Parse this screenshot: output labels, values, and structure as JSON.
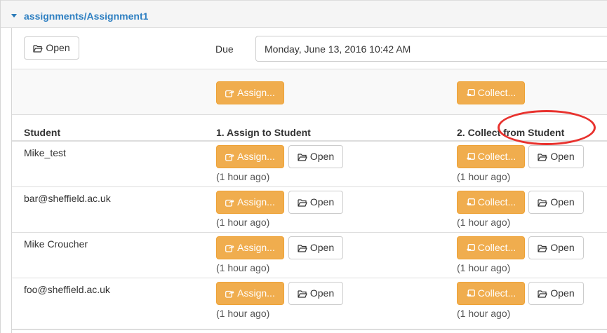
{
  "assignment": {
    "title": "assignments/Assignment1",
    "open_label": "Open",
    "due_label": "Due",
    "due_value": "Monday, June 13, 2016 10:42 AM",
    "assign_all_label": "Assign...",
    "collect_all_label": "Collect..."
  },
  "table": {
    "headers": {
      "student": "Student",
      "assign": "1. Assign to Student",
      "collect": "2. Collect from Student"
    },
    "assign_label": "Assign...",
    "collect_label": "Collect...",
    "open_label": "Open",
    "rows": [
      {
        "student": "Mike_test",
        "assign_ago": "(1 hour ago)",
        "collect_ago": "(1 hour ago)"
      },
      {
        "student": "bar@sheffield.ac.uk",
        "assign_ago": "(1 hour ago)",
        "collect_ago": "(1 hour ago)"
      },
      {
        "student": "Mike Croucher",
        "assign_ago": "(1 hour ago)",
        "collect_ago": "(1 hour ago)"
      },
      {
        "student": "foo@sheffield.ac.uk",
        "assign_ago": "(1 hour ago)",
        "collect_ago": "(1 hour ago)"
      }
    ]
  },
  "icons": {
    "caret": "caret-down-icon",
    "folder": "folder-open-icon",
    "share": "share-icon",
    "collect": "collect-icon"
  },
  "colors": {
    "link": "#2f80c2",
    "warning": "#f0ad4e",
    "highlight": "#e8322e"
  }
}
